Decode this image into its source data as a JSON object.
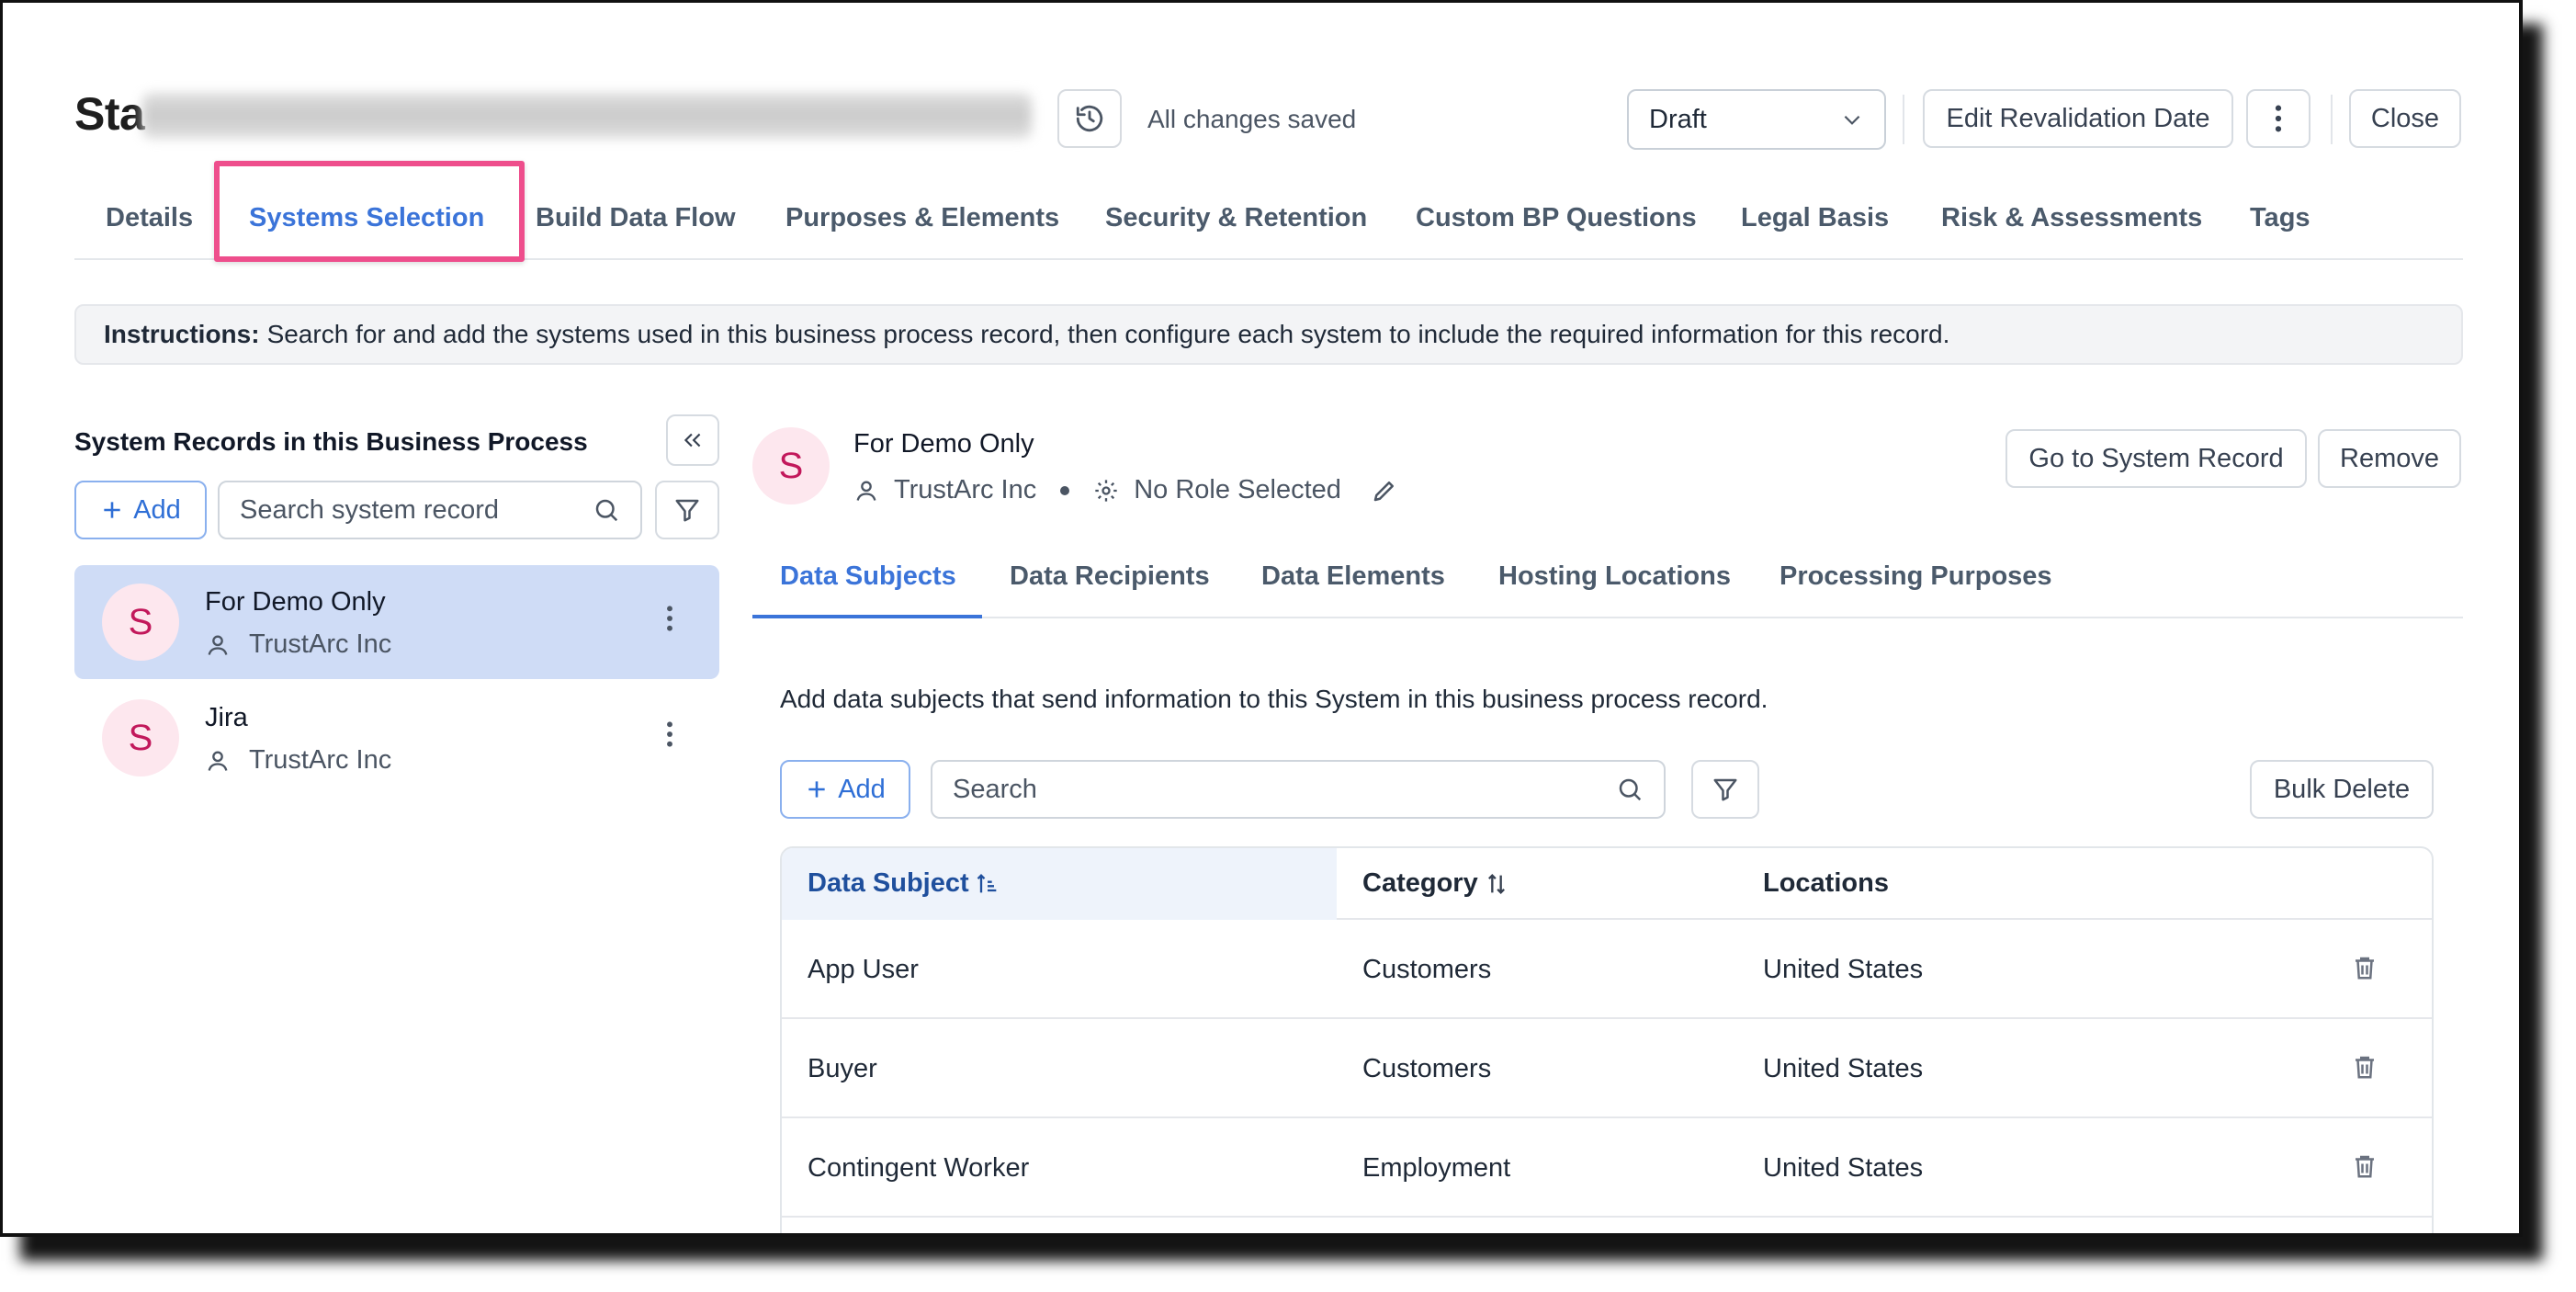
{
  "header": {
    "title_visible": "Sta",
    "save_status": "All changes saved",
    "status_select": "Draft",
    "edit_revalidation_label": "Edit Revalidation Date",
    "close_label": "Close"
  },
  "tabs": [
    {
      "label": "Details"
    },
    {
      "label": "Systems Selection"
    },
    {
      "label": "Build Data Flow"
    },
    {
      "label": "Purposes & Elements"
    },
    {
      "label": "Security & Retention"
    },
    {
      "label": "Custom BP Questions"
    },
    {
      "label": "Legal Basis"
    },
    {
      "label": "Risk & Assessments"
    },
    {
      "label": "Tags"
    }
  ],
  "instructions": {
    "label": "Instructions:",
    "text": "Search for and add the systems used in this business process record, then configure each system to include the required information for this record."
  },
  "left_panel": {
    "title": "System Records in this Business Process",
    "add_label": "Add",
    "search_placeholder": "Search system record",
    "systems": [
      {
        "initial": "S",
        "name": "For Demo Only",
        "owner": "TrustArc Inc"
      },
      {
        "initial": "S",
        "name": "Jira",
        "owner": "TrustArc Inc"
      }
    ]
  },
  "right_panel": {
    "initial": "S",
    "name": "For Demo Only",
    "owner": "TrustArc Inc",
    "role": "No Role Selected",
    "goto_label": "Go to System Record",
    "remove_label": "Remove",
    "subtabs": [
      {
        "label": "Data Subjects"
      },
      {
        "label": "Data Recipients"
      },
      {
        "label": "Data Elements"
      },
      {
        "label": "Hosting Locations"
      },
      {
        "label": "Processing Purposes"
      }
    ],
    "description": "Add data subjects that send information to this System in this business process record.",
    "add_label": "Add",
    "search_placeholder": "Search",
    "bulk_delete_label": "Bulk Delete",
    "table": {
      "columns": [
        "Data Subject",
        "Category",
        "Locations"
      ],
      "rows": [
        {
          "subject": "App User",
          "category": "Customers",
          "location": "United States"
        },
        {
          "subject": "Buyer",
          "category": "Customers",
          "location": "United States"
        },
        {
          "subject": "Contingent Worker",
          "category": "Employment",
          "location": "United States"
        }
      ]
    }
  },
  "colors": {
    "accent": "#3b74d9",
    "highlight": "#ee4e8c",
    "selected_row": "#cfdcf6",
    "avatar_bg": "#fde7ee",
    "avatar_fg": "#c2185b"
  }
}
